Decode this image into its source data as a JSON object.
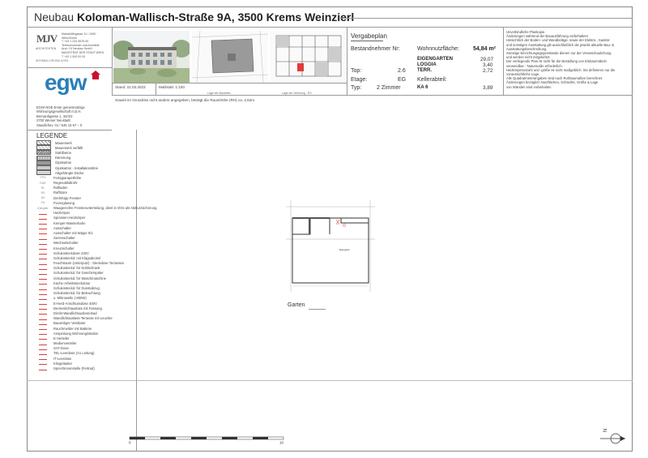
{
  "header": {
    "prefix": "Neubau",
    "address": "Koloman-Wallisch-Straße 9A, 3500 Krems Weinzierl"
  },
  "architect": {
    "logo_text": "MJV",
    "logo_sub": "ARCHITEKTEN",
    "info_lines": [
      "Mariahilfergasse 11 / 1090 · Wien/Zürich",
      "T +43 1 234 5678 00",
      "Telefonnummer und Architekt",
      "Arch. DI Neubau GmbH",
      "MAGISTRAT DER STADT WIEN",
      "T +43 1 000 00 00"
    ],
    "footer": "WOHNBAU GRUNDLAGEN"
  },
  "client": {
    "logo_text": "egw",
    "brand_color": "#2a7fb8",
    "mark_color": "#c8102e",
    "info_lines": [
      "EGW-NOE Erste gemeinnützige",
      "Wohnungsgesellschaft m.b.H.",
      "Bernardigasse 1, 34/4/3",
      "2700 Wiener Neustadt",
      "Staatlichev. 01 / 545 15 67 – 0"
    ]
  },
  "legend": {
    "title": "LEGENDE",
    "items": [
      {
        "sym": "",
        "label": "Mauerwerk"
      },
      {
        "sym": "",
        "label": "Mauerwerk verfällt"
      },
      {
        "sym": "",
        "label": "Stahlbeton"
      },
      {
        "sym": "",
        "label": "Dämmung"
      },
      {
        "sym": "",
        "label": "Gipskarton"
      },
      {
        "sym": "",
        "label": "Gipskarton - Installationsbrei"
      },
      {
        "sym": "",
        "label": "Abgehängte Decke"
      },
      {
        "sym": "FPH",
        "label": "Fertigparapethöhe"
      },
      {
        "sym": "RAR",
        "label": "Regenabfallrohr"
      },
      {
        "sym": "RL",
        "label": "Rollladen"
      },
      {
        "sym": "RS",
        "label": "Raffstore"
      },
      {
        "sym": "DK",
        "label": "Dreh/Kipp Fenster"
      },
      {
        "sym": "Fix",
        "label": "Fixverglasung"
      },
      {
        "sym": "Kämpfer",
        "label": "Waagerechte Fensterunterteilung, dient in OGs als Absturzsicherung"
      },
      {
        "sym": "",
        "label": "Heizkörper"
      },
      {
        "sym": "",
        "label": "Sprossen-Heizkörper"
      },
      {
        "sym": "",
        "label": "Kemper-Wasserhahn"
      },
      {
        "sym": "",
        "label": "Ausschalter"
      },
      {
        "sym": "",
        "label": "Ausschalter mit Wippe 0/1"
      },
      {
        "sym": "",
        "label": "Serienschalter"
      },
      {
        "sym": "",
        "label": "Wechselschalter"
      },
      {
        "sym": "",
        "label": "Kreuzschalter"
      },
      {
        "sym": "",
        "label": "Schukosteckdose 230V"
      },
      {
        "sym": "",
        "label": "Schukosteckd. mit Klappdeckel"
      },
      {
        "sym": "",
        "label": "Feuchtraum (Unterputz) - Steckdose Terrassen"
      },
      {
        "sym": "",
        "label": "Schukosteckd. für Kühlschrank"
      },
      {
        "sym": "",
        "label": "Schukosteckd. für Geschirrspüler"
      },
      {
        "sym": "",
        "label": "Schukosteckd. für Waschmaschine"
      },
      {
        "sym": "",
        "label": "Küche-Arbeitssteckdose"
      },
      {
        "sym": "",
        "label": "Schukosteckd. für Dunstabzug"
      },
      {
        "sym": "",
        "label": "Schukosteckd. für Beleuchtung"
      },
      {
        "sym": "",
        "label": "u. Mikrowelle (-800W)"
      },
      {
        "sym": "",
        "label": "E-Herd-Anschlussdose 400V"
      },
      {
        "sym": "",
        "label": "Deckenlichtauslass mit Fassung"
      },
      {
        "sym": "",
        "label": "Direkt-Wandlichtauslass-Bad"
      },
      {
        "sym": "",
        "label": "Wandlichtauslass-Terrasse mit Leuchte"
      },
      {
        "sym": "",
        "label": "Bauseitiger Ventilator"
      },
      {
        "sym": "",
        "label": "Rauchmelder mit Batterie"
      },
      {
        "sym": "",
        "label": "Anspeisung Wohnungsstation"
      },
      {
        "sym": "",
        "label": "E-Verteiler"
      },
      {
        "sym": "",
        "label": "Medienverteiler"
      },
      {
        "sym": "",
        "label": "SAT-Dose"
      },
      {
        "sym": "",
        "label": "TEL-Leerdose (A1 Leitung)"
      },
      {
        "sym": "",
        "label": "IT-Leerdose"
      },
      {
        "sym": "",
        "label": "Klingeltaster"
      },
      {
        "sym": "",
        "label": "Sprechinnenstelle (Fertrad)"
      }
    ]
  },
  "images": {
    "caption1": "Lage des Bauteiles",
    "caption2": "Lage der Wohnung - EG"
  },
  "meta": {
    "stand": "Stand: 31.03.2023",
    "massstab": "Maßstab: 1:100",
    "raumhoehe": "Soweit im Grundriss nicht anders angegeben, beträgt die Raumhöhe (RH) ca. 2,52m"
  },
  "vergabeplan": {
    "title": "Vergabeplan",
    "bestandnehmer_label": "Bestandnehmer Nr:",
    "top_label": "Top:",
    "top_value": "2.6",
    "etage_label": "Etage:",
    "etage_value": "EG",
    "typ_label": "Typ:",
    "typ_value": "2 Zimmer",
    "wnf_label": "Wohnnutzfläche:",
    "wnf_value": "54,84 m²",
    "eigengarten_label": "EIGENGARTEN",
    "eigengarten_value": "29,07",
    "loggia_label": "LOGGIA",
    "loggia_value": "3,40",
    "terr_label": "TERR.",
    "terr_value": "2,72",
    "kellerabteil_label": "Kellerabteil:",
    "ka_label": "KA 6",
    "ka_value": "3,89"
  },
  "notes": {
    "lines": [
      "Unverbindliche Plankopie.",
      "Änderungen während der Bauausführung vorbehalten!",
      "Hinsichtlich der Boden- und Wandbeläge, sowie der Elektro-, Sanitär-",
      "und sonstigen Ausstattung gilt ausschließlich die jeweils aktuelle Bau- &",
      "Ausstattungsbeschreibung.",
      "Sonstige Einrichtungsgegenstände dienen nur der Veranschaulichung",
      "und werden nicht mitgeliefert.",
      "Der vorliegende Plan ist nicht für die Bestellung von Einbaumöbeln",
      "verwendbar - Naturmaße erforderlich.",
      "Heizkörperanzahl und -größe ist nicht maßgeblich. Sie definieren nur die",
      "voraussichtliche Lage.",
      "Alle Quadratmeterangaben sind nach Rohbaumaßen berechnet.",
      "Änderungen bezüglich Nutzflächen, Schächte, Größe & Lage",
      "von Wänden sind vorbehalten"
    ]
  },
  "plan": {
    "room_label": "Eigengarten",
    "garten_label": "Garten"
  },
  "scale_bar": {
    "start": "0",
    "end": "10"
  },
  "north_label": "N"
}
